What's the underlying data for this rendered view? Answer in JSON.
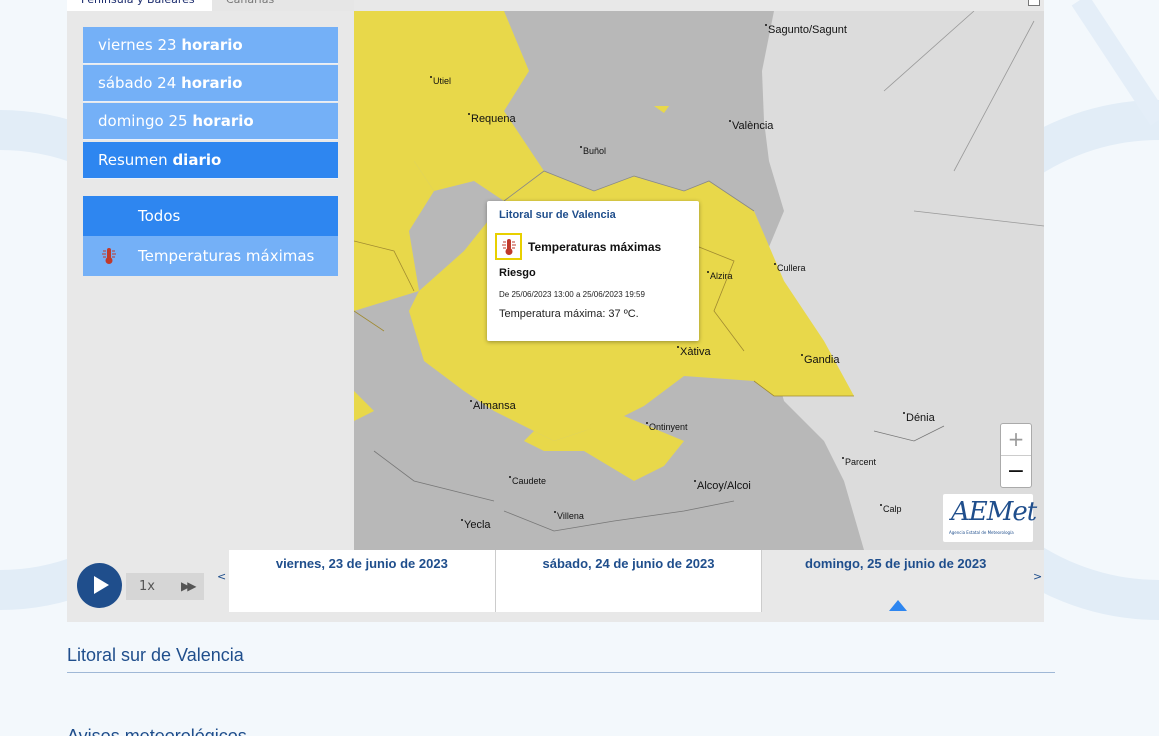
{
  "region_tabs": [
    "Península y Baleares",
    "Canarias"
  ],
  "days": [
    {
      "prefix": "viernes 23",
      "bold": "horario"
    },
    {
      "prefix": "sábado 24",
      "bold": "horario"
    },
    {
      "prefix": "domingo 25",
      "bold": "horario"
    },
    {
      "prefix": "Resumen",
      "bold": "diario"
    }
  ],
  "filters": {
    "all": "Todos",
    "temp": "Temperaturas máximas"
  },
  "cities": {
    "sagunto": "Sagunto/Sagunt",
    "utiel": "Utiel",
    "requena": "Requena",
    "valencia": "València",
    "bunol": "Buñol",
    "alzira": "Alzira",
    "cullera": "Cullera",
    "xativa": "Xàtiva",
    "gandia": "Gandia",
    "almansa": "Almansa",
    "ontinyent": "Ontinyent",
    "denia": "Dénia",
    "parcent": "Parcent",
    "caudete": "Caudete",
    "alcoy": "Alcoy/Alcoi",
    "villena": "Villena",
    "calp": "Calp",
    "yecla": "Yecla"
  },
  "popup": {
    "title": "Litoral sur de Valencia",
    "warning": "Temperaturas máximas",
    "level": "Riesgo",
    "period": "De 25/06/2023 13:00 a 25/06/2023 19:59",
    "detail": "Temperatura máxima: 37 ºC."
  },
  "zoom": {
    "in": "+",
    "out": "−"
  },
  "logo": {
    "text": "AEMet",
    "sub": "Agencia Estatal de Meteorología"
  },
  "player": {
    "speed": "1x",
    "ff": "▶▶",
    "prev": "<",
    "next": ">"
  },
  "timeline_days": [
    "viernes, 23 de junio de 2023",
    "sábado, 24 de junio de 2023",
    "domingo, 25 de junio de 2023"
  ],
  "zone_title": "Litoral sur de Valencia",
  "avisos_title": "Avisos meteorológicos",
  "colors": {
    "warning_yellow": "#e8d84a",
    "land_gray": "#b8b8b8",
    "sea_gray": "#dcdcdc",
    "accent": "#2e86f0",
    "navy": "#1f4e8c"
  }
}
